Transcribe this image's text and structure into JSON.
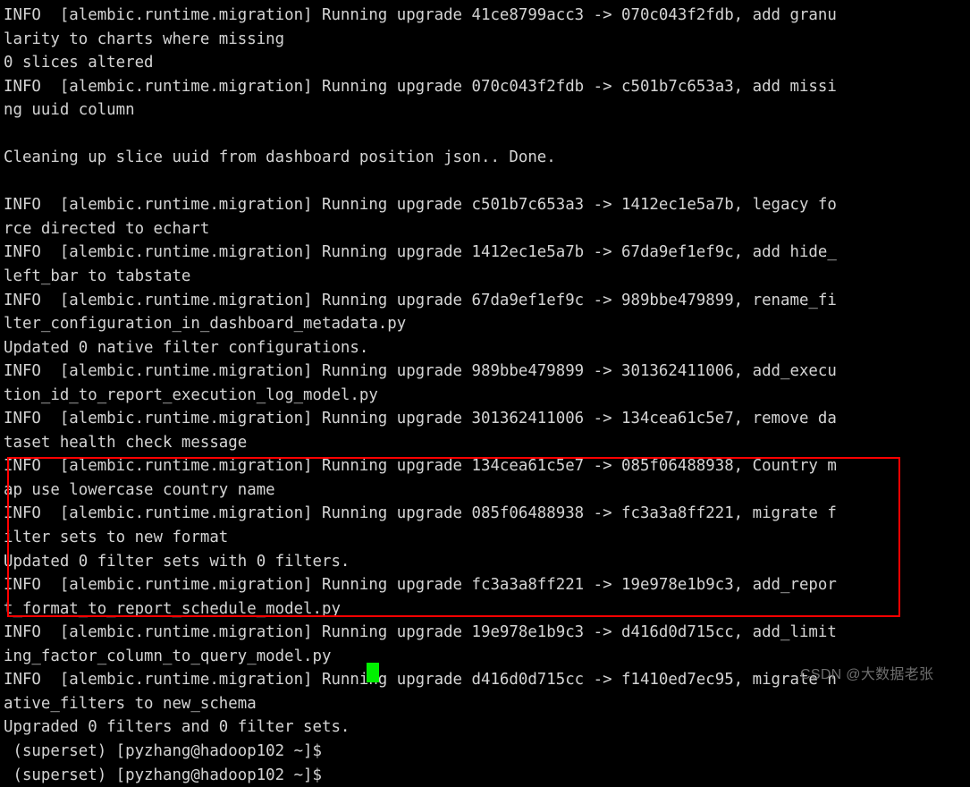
{
  "terminal": {
    "background_color": "#000000",
    "foreground_color": "#d4d4d4",
    "cursor_color": "#00f000",
    "annotation_color": "#ff0000",
    "lines": [
      "INFO  [alembic.runtime.migration] Running upgrade 41ce8799acc3 -> 070c043f2fdb, add granu",
      "larity to charts where missing",
      "0 slices altered",
      "INFO  [alembic.runtime.migration] Running upgrade 070c043f2fdb -> c501b7c653a3, add missi",
      "ng uuid column",
      "",
      "Cleaning up slice uuid from dashboard position json.. Done.",
      "",
      "INFO  [alembic.runtime.migration] Running upgrade c501b7c653a3 -> 1412ec1e5a7b, legacy fo",
      "rce directed to echart",
      "INFO  [alembic.runtime.migration] Running upgrade 1412ec1e5a7b -> 67da9ef1ef9c, add hide_",
      "left_bar to tabstate",
      "INFO  [alembic.runtime.migration] Running upgrade 67da9ef1ef9c -> 989bbe479899, rename_fi",
      "lter_configuration_in_dashboard_metadata.py",
      "Updated 0 native filter configurations.",
      "INFO  [alembic.runtime.migration] Running upgrade 989bbe479899 -> 301362411006, add_execu",
      "tion_id_to_report_execution_log_model.py",
      "INFO  [alembic.runtime.migration] Running upgrade 301362411006 -> 134cea61c5e7, remove da",
      "taset health check message",
      "INFO  [alembic.runtime.migration] Running upgrade 134cea61c5e7 -> 085f06488938, Country m",
      "ap use lowercase country name",
      "INFO  [alembic.runtime.migration] Running upgrade 085f06488938 -> fc3a3a8ff221, migrate f",
      "ilter sets to new format",
      "Updated 0 filter sets with 0 filters.",
      "INFO  [alembic.runtime.migration] Running upgrade fc3a3a8ff221 -> 19e978e1b9c3, add_repor",
      "t_format_to_report_schedule_model.py",
      "INFO  [alembic.runtime.migration] Running upgrade 19e978e1b9c3 -> d416d0d715cc, add_limit",
      "ing_factor_column_to_query_model.py",
      "INFO  [alembic.runtime.migration] Running upgrade d416d0d715cc -> f1410ed7ec95, migrate n",
      "ative_filters to new_schema",
      "Upgraded 0 filters and 0 filter sets.",
      " (superset) [pyzhang@hadoop102 ~]$",
      " (superset) [pyzhang@hadoop102 ~]$ "
    ]
  },
  "watermark": {
    "text": "CSDN @大数据老张"
  }
}
